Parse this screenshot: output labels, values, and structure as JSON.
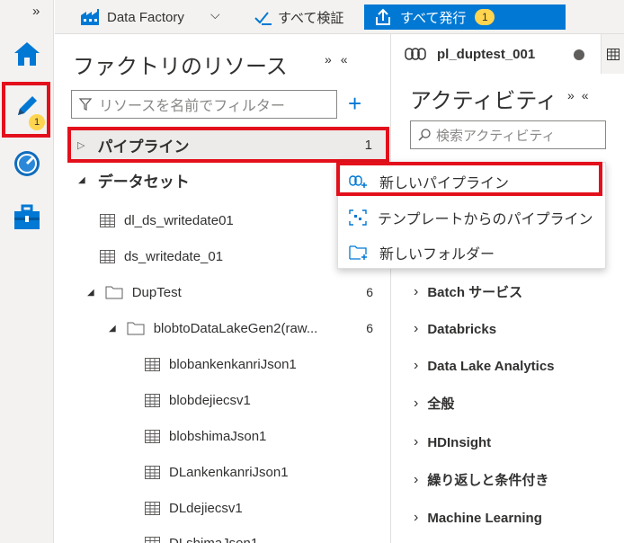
{
  "topbar": {
    "factory_name": "Data Factory",
    "validate_all": "すべて検証",
    "publish_all": "すべて発行",
    "publish_count": "1"
  },
  "rail": {
    "author_badge": "1"
  },
  "resources": {
    "title": "ファクトリのリソース",
    "filter_placeholder": "リソースを名前でフィルター",
    "pipelines_label": "パイプライン",
    "pipelines_count": "1",
    "datasets_label": "データセット",
    "items": [
      {
        "label": "dl_ds_writedate01",
        "count": ""
      },
      {
        "label": "ds_writedate_01",
        "count": ""
      },
      {
        "label": "DupTest",
        "count": "6"
      },
      {
        "label": "blobtoDataLakeGen2(raw...",
        "count": "6"
      },
      {
        "label": "blobankenkanriJson1",
        "count": ""
      },
      {
        "label": "blobdejiecsv1",
        "count": ""
      },
      {
        "label": "blobshimaJson1",
        "count": ""
      },
      {
        "label": "DLankenkanriJson1",
        "count": ""
      },
      {
        "label": "DLdejiecsv1",
        "count": ""
      },
      {
        "label": "DLshimaJson1",
        "count": ""
      }
    ]
  },
  "menu": {
    "items": [
      {
        "label": "新しいパイプライン"
      },
      {
        "label": "テンプレートからのパイプライン"
      },
      {
        "label": "新しいフォルダー"
      }
    ]
  },
  "activities": {
    "tab_label": "pl_duptest_001",
    "title": "アクティビティ",
    "search_placeholder": "検索アクティビティ",
    "groups": [
      {
        "label": "Batch サービス"
      },
      {
        "label": "Databricks"
      },
      {
        "label": "Data Lake Analytics"
      },
      {
        "label": "全般"
      },
      {
        "label": "HDInsight"
      },
      {
        "label": "繰り返しと条件付き"
      },
      {
        "label": "Machine Learning"
      }
    ]
  },
  "colors": {
    "accent": "#0078d4",
    "highlight": "#e3101c",
    "badge": "#ffd54f"
  }
}
